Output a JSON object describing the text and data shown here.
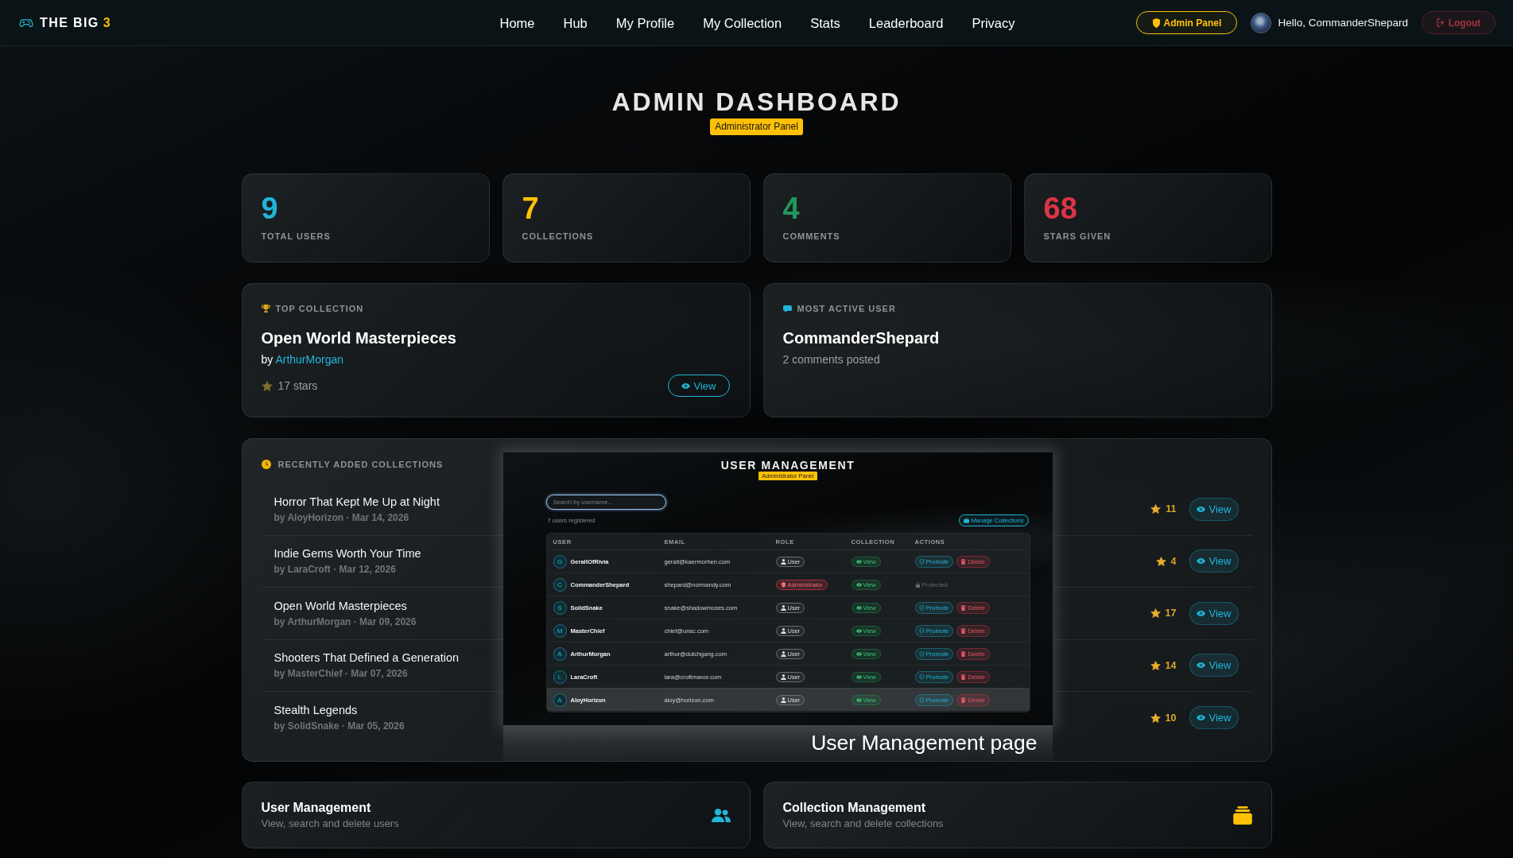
{
  "navbar": {
    "brand": {
      "name": "THE BIG",
      "accent": "3"
    },
    "links": [
      {
        "label": "Home"
      },
      {
        "label": "Hub"
      },
      {
        "label": "My Profile"
      },
      {
        "label": "My Collection"
      },
      {
        "label": "Stats"
      },
      {
        "label": "Leaderboard"
      },
      {
        "label": "Privacy"
      }
    ],
    "admin_button": "Admin Panel",
    "greeting": "Hello, CommanderShepard",
    "logout_button": "Logout"
  },
  "header": {
    "title": "ADMIN DASHBOARD",
    "badge": "Administrator Panel"
  },
  "stats": [
    {
      "value": "9",
      "label": "TOTAL USERS",
      "color": "#21b5d8"
    },
    {
      "value": "7",
      "label": "COLLECTIONS",
      "color": "#ffc107"
    },
    {
      "value": "4",
      "label": "COMMENTS",
      "color": "#22975c"
    },
    {
      "value": "68",
      "label": "STARS GIVEN",
      "color": "#dc3545"
    }
  ],
  "top_collection": {
    "heading": "TOP COLLECTION",
    "title": "Open World Masterpieces",
    "by": "by",
    "author": "ArthurMorgan",
    "star_count": "17 stars",
    "button": "View"
  },
  "most_active_user": {
    "heading": "MOST ACTIVE USER",
    "name": "CommanderShepard",
    "detail": "2 comments posted"
  },
  "recent_collections": {
    "heading": "RECENTLY ADDED COLLECTIONS",
    "items": [
      {
        "title": "Horror That Kept Me Up at Night",
        "meta": "by AloyHorizon · Mar 14, 2026",
        "star_count": "11",
        "button": "View"
      },
      {
        "title": "Indie Gems Worth Your Time",
        "meta": "by LaraCroft · Mar 12, 2026",
        "star_count": "4",
        "button": "View"
      },
      {
        "title": "Open World Masterpieces",
        "meta": "by ArthurMorgan · Mar 09, 2026",
        "star_count": "17",
        "button": "View"
      },
      {
        "title": "Shooters That Defined a Generation",
        "meta": "by MasterChief · Mar 07, 2026",
        "star_count": "14",
        "button": "View"
      },
      {
        "title": "Stealth Legends",
        "meta": "by SolidSnake · Mar 05, 2026",
        "star_count": "10",
        "button": "View"
      }
    ]
  },
  "inset": {
    "title": "USER MANAGEMENT",
    "badge": "Administrator Panel",
    "search": {
      "placeholder": "Search by username..."
    },
    "count": "7 users registered",
    "manage_button": "Manage Collections",
    "table": {
      "columns": [
        "USER",
        "EMAIL",
        "ROLE",
        "COLLECTION",
        "ACTIONS"
      ],
      "rows": [
        {
          "initial": "G",
          "user": "GeraltOfRivia",
          "email": "geralt@kaermorhen.com",
          "role": {
            "label": "User",
            "kind": "user"
          },
          "collection": "View",
          "actions": [
            {
              "label": "Promote",
              "kind": "promote"
            },
            {
              "label": "Delete",
              "kind": "delete"
            }
          ],
          "hovered": false
        },
        {
          "initial": "C",
          "user": "CommanderShepard",
          "email": "shepard@normandy.com",
          "role": {
            "label": "Administrator",
            "kind": "admin"
          },
          "collection": "View",
          "actions": [
            {
              "label": "Protected",
              "kind": "protected"
            }
          ],
          "hovered": false
        },
        {
          "initial": "S",
          "user": "SolidSnake",
          "email": "snake@shadowmoses.com",
          "role": {
            "label": "User",
            "kind": "user"
          },
          "collection": "View",
          "actions": [
            {
              "label": "Promote",
              "kind": "promote"
            },
            {
              "label": "Delete",
              "kind": "delete"
            }
          ],
          "hovered": false
        },
        {
          "initial": "M",
          "user": "MasterChief",
          "email": "chief@unsc.com",
          "role": {
            "label": "User",
            "kind": "user"
          },
          "collection": "View",
          "actions": [
            {
              "label": "Promote",
              "kind": "promote"
            },
            {
              "label": "Delete",
              "kind": "delete"
            }
          ],
          "hovered": false
        },
        {
          "initial": "A",
          "user": "ArthurMorgan",
          "email": "arthur@dutchgang.com",
          "role": {
            "label": "User",
            "kind": "user"
          },
          "collection": "View",
          "actions": [
            {
              "label": "Promote",
              "kind": "promote"
            },
            {
              "label": "Delete",
              "kind": "delete"
            }
          ],
          "hovered": false
        },
        {
          "initial": "L",
          "user": "LaraCroft",
          "email": "lara@croftmanor.com",
          "role": {
            "label": "User",
            "kind": "user"
          },
          "collection": "View",
          "actions": [
            {
              "label": "Promote",
              "kind": "promote"
            },
            {
              "label": "Delete",
              "kind": "delete"
            }
          ],
          "hovered": false
        },
        {
          "initial": "A",
          "user": "AloyHorizon",
          "email": "aloy@horizon.com",
          "role": {
            "label": "User",
            "kind": "user"
          },
          "collection": "View",
          "actions": [
            {
              "label": "Promote",
              "kind": "promote"
            },
            {
              "label": "Delete",
              "kind": "delete"
            }
          ],
          "hovered": true
        }
      ]
    },
    "caption": "User Management page"
  },
  "management": [
    {
      "title": "User Management",
      "description": "View, search and delete users",
      "kind": "users"
    },
    {
      "title": "Collection Management",
      "description": "View, search and delete collections",
      "kind": "collections"
    }
  ]
}
